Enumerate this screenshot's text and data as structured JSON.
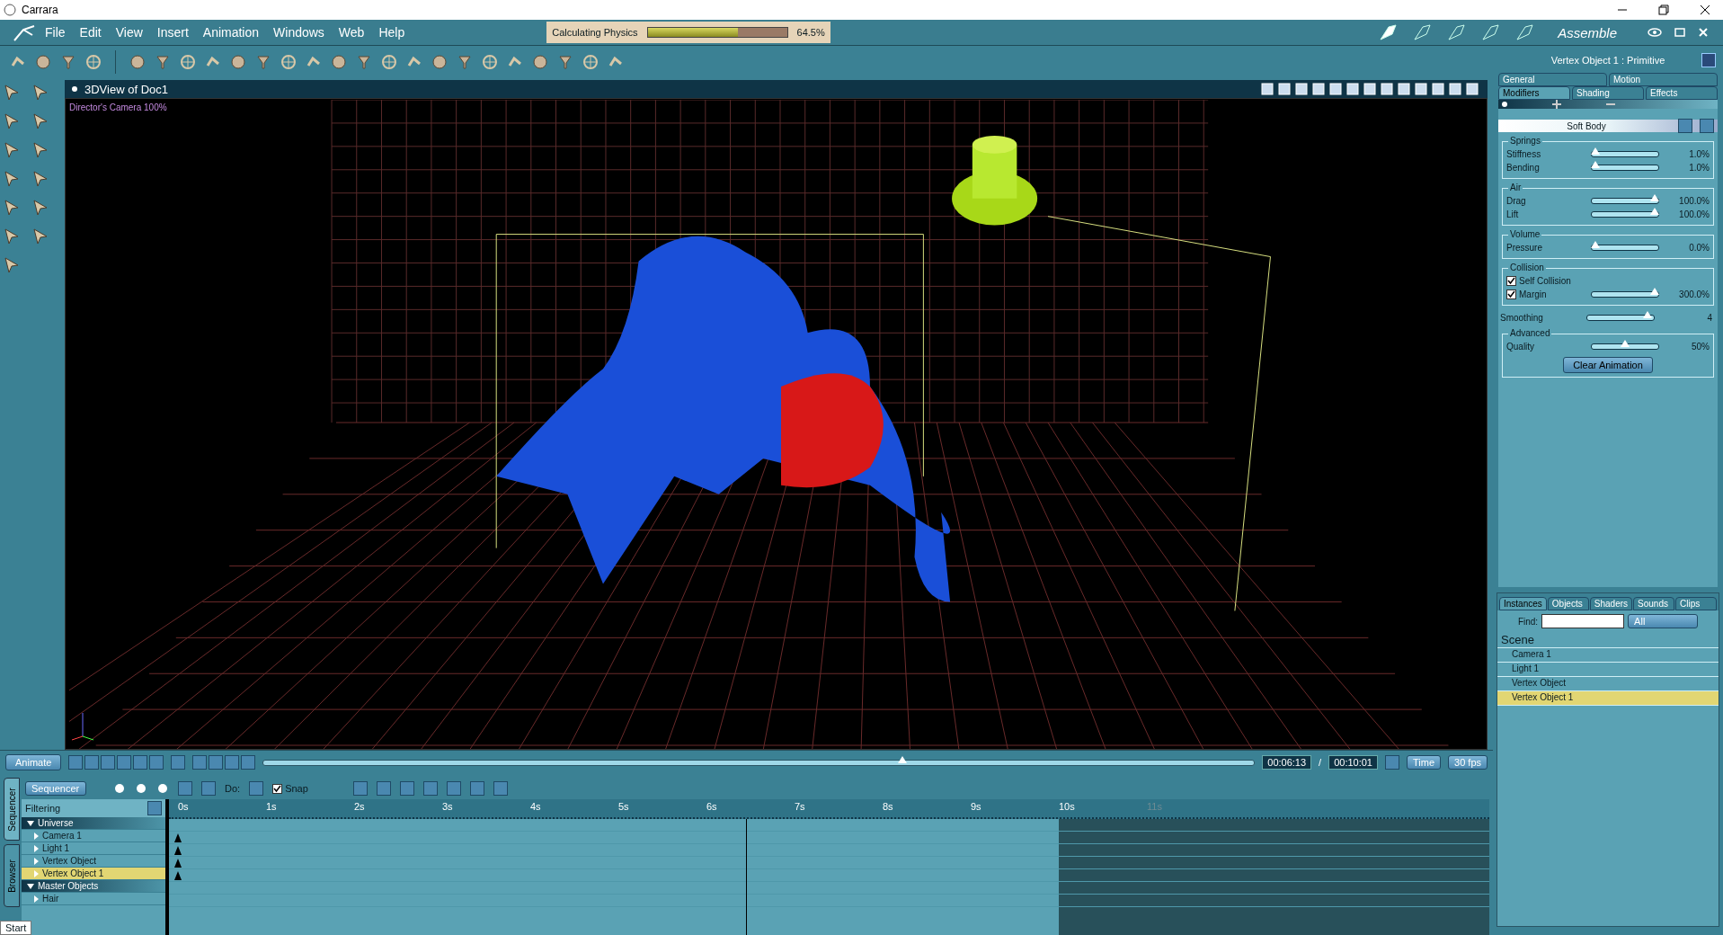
{
  "window": {
    "title": "Carrara"
  },
  "menu": [
    "File",
    "Edit",
    "View",
    "Insert",
    "Animation",
    "Windows",
    "Web",
    "Help"
  ],
  "progress": {
    "label": "Calculating Physics",
    "level": 0.645,
    "reading": "64.5%"
  },
  "room": "Assemble",
  "view": {
    "title": "3DView of Doc1",
    "camera_label": "Director's Camera 100%"
  },
  "properties": {
    "title": "Vertex Object 1 : Primitive",
    "tabs": [
      [
        {
          "label": "General",
          "selected": false
        },
        {
          "label": "Motion",
          "selected": false
        }
      ],
      [
        {
          "label": "Modifiers",
          "selected": true
        },
        {
          "label": "Shading",
          "selected": false
        },
        {
          "label": "Effects",
          "selected": false
        }
      ]
    ],
    "modifier": "Soft Body",
    "sections": [
      {
        "kind": "group",
        "title": "Springs",
        "rows": [
          {
            "kind": "slider",
            "label": "Stiffness",
            "level": 0.05,
            "reading": "1.0%"
          },
          {
            "kind": "slider",
            "label": "Bending",
            "level": 0.05,
            "reading": "1.0%"
          }
        ]
      },
      {
        "kind": "group",
        "title": "Air",
        "rows": [
          {
            "kind": "slider",
            "label": "Drag",
            "level": 0.95,
            "reading": "100.0%"
          },
          {
            "kind": "slider",
            "label": "Lift",
            "level": 0.95,
            "reading": "100.0%"
          }
        ]
      },
      {
        "kind": "group",
        "title": "Volume",
        "rows": [
          {
            "kind": "slider",
            "label": "Pressure",
            "level": 0.05,
            "reading": "0.0%"
          }
        ]
      },
      {
        "kind": "group",
        "title": "Collision",
        "rows": [
          {
            "kind": "checkbox",
            "label": "Self Collision",
            "checked": true
          },
          {
            "kind": "checkslider",
            "label": "Margin",
            "checked": true,
            "level": 0.95,
            "reading": "300.0%"
          }
        ]
      },
      {
        "kind": "slider",
        "label": "Smoothing",
        "level": 0.9,
        "reading": "4"
      },
      {
        "kind": "group",
        "title": "Advanced",
        "rows": [
          {
            "kind": "slider",
            "label": "Quality",
            "level": 0.5,
            "reading": "50%"
          }
        ],
        "button": "Clear Animation"
      }
    ]
  },
  "browser": {
    "tabs": [
      {
        "label": "Instances",
        "selected": true
      },
      {
        "label": "Objects",
        "selected": false
      },
      {
        "label": "Shaders",
        "selected": false
      },
      {
        "label": "Sounds",
        "selected": false
      },
      {
        "label": "Clips",
        "selected": false
      }
    ],
    "find_label": "Find:",
    "filter": "All",
    "scene": "Scene",
    "items": [
      {
        "label": "Camera 1",
        "selected": false
      },
      {
        "label": "Light 1",
        "selected": false
      },
      {
        "label": "Vertex Object",
        "selected": false
      },
      {
        "label": "Vertex Object 1",
        "selected": true
      }
    ]
  },
  "animation": {
    "button": "Animate",
    "level": 0.645,
    "current": "00:06:13",
    "separator": "/",
    "total": "00:10:01",
    "unit": "Time",
    "fps": "30 fps"
  },
  "sequencer": {
    "side_tabs": [
      {
        "label": "Sequencer",
        "selected": true
      },
      {
        "label": "Browser",
        "selected": false
      }
    ],
    "mode": "Sequencer",
    "do_label": "Do:",
    "snap": {
      "label": "Snap",
      "checked": true
    },
    "filtering": "Filtering",
    "ticks": [
      {
        "label": "0s",
        "in_range": true
      },
      {
        "label": "1s",
        "in_range": true
      },
      {
        "label": "2s",
        "in_range": true
      },
      {
        "label": "3s",
        "in_range": true
      },
      {
        "label": "4s",
        "in_range": true
      },
      {
        "label": "5s",
        "in_range": true
      },
      {
        "label": "6s",
        "in_range": true
      },
      {
        "label": "7s",
        "in_range": true
      },
      {
        "label": "8s",
        "in_range": true
      },
      {
        "label": "9s",
        "in_range": true
      },
      {
        "label": "10s",
        "in_range": true
      },
      {
        "label": "11s",
        "in_range": false
      }
    ],
    "tree": [
      {
        "label": "Universe",
        "expanded": true,
        "children": [
          {
            "label": "Camera 1",
            "selected": false,
            "keyframe": true
          },
          {
            "label": "Light 1",
            "selected": false,
            "keyframe": true
          },
          {
            "label": "Vertex Object",
            "selected": false,
            "keyframe": true
          },
          {
            "label": "Vertex Object 1",
            "selected": true,
            "keyframe": true
          }
        ]
      },
      {
        "label": "Master Objects",
        "expanded": true,
        "children": [
          {
            "label": "Hair",
            "selected": false,
            "keyframe": false
          }
        ]
      }
    ]
  },
  "tooltip": "Start"
}
